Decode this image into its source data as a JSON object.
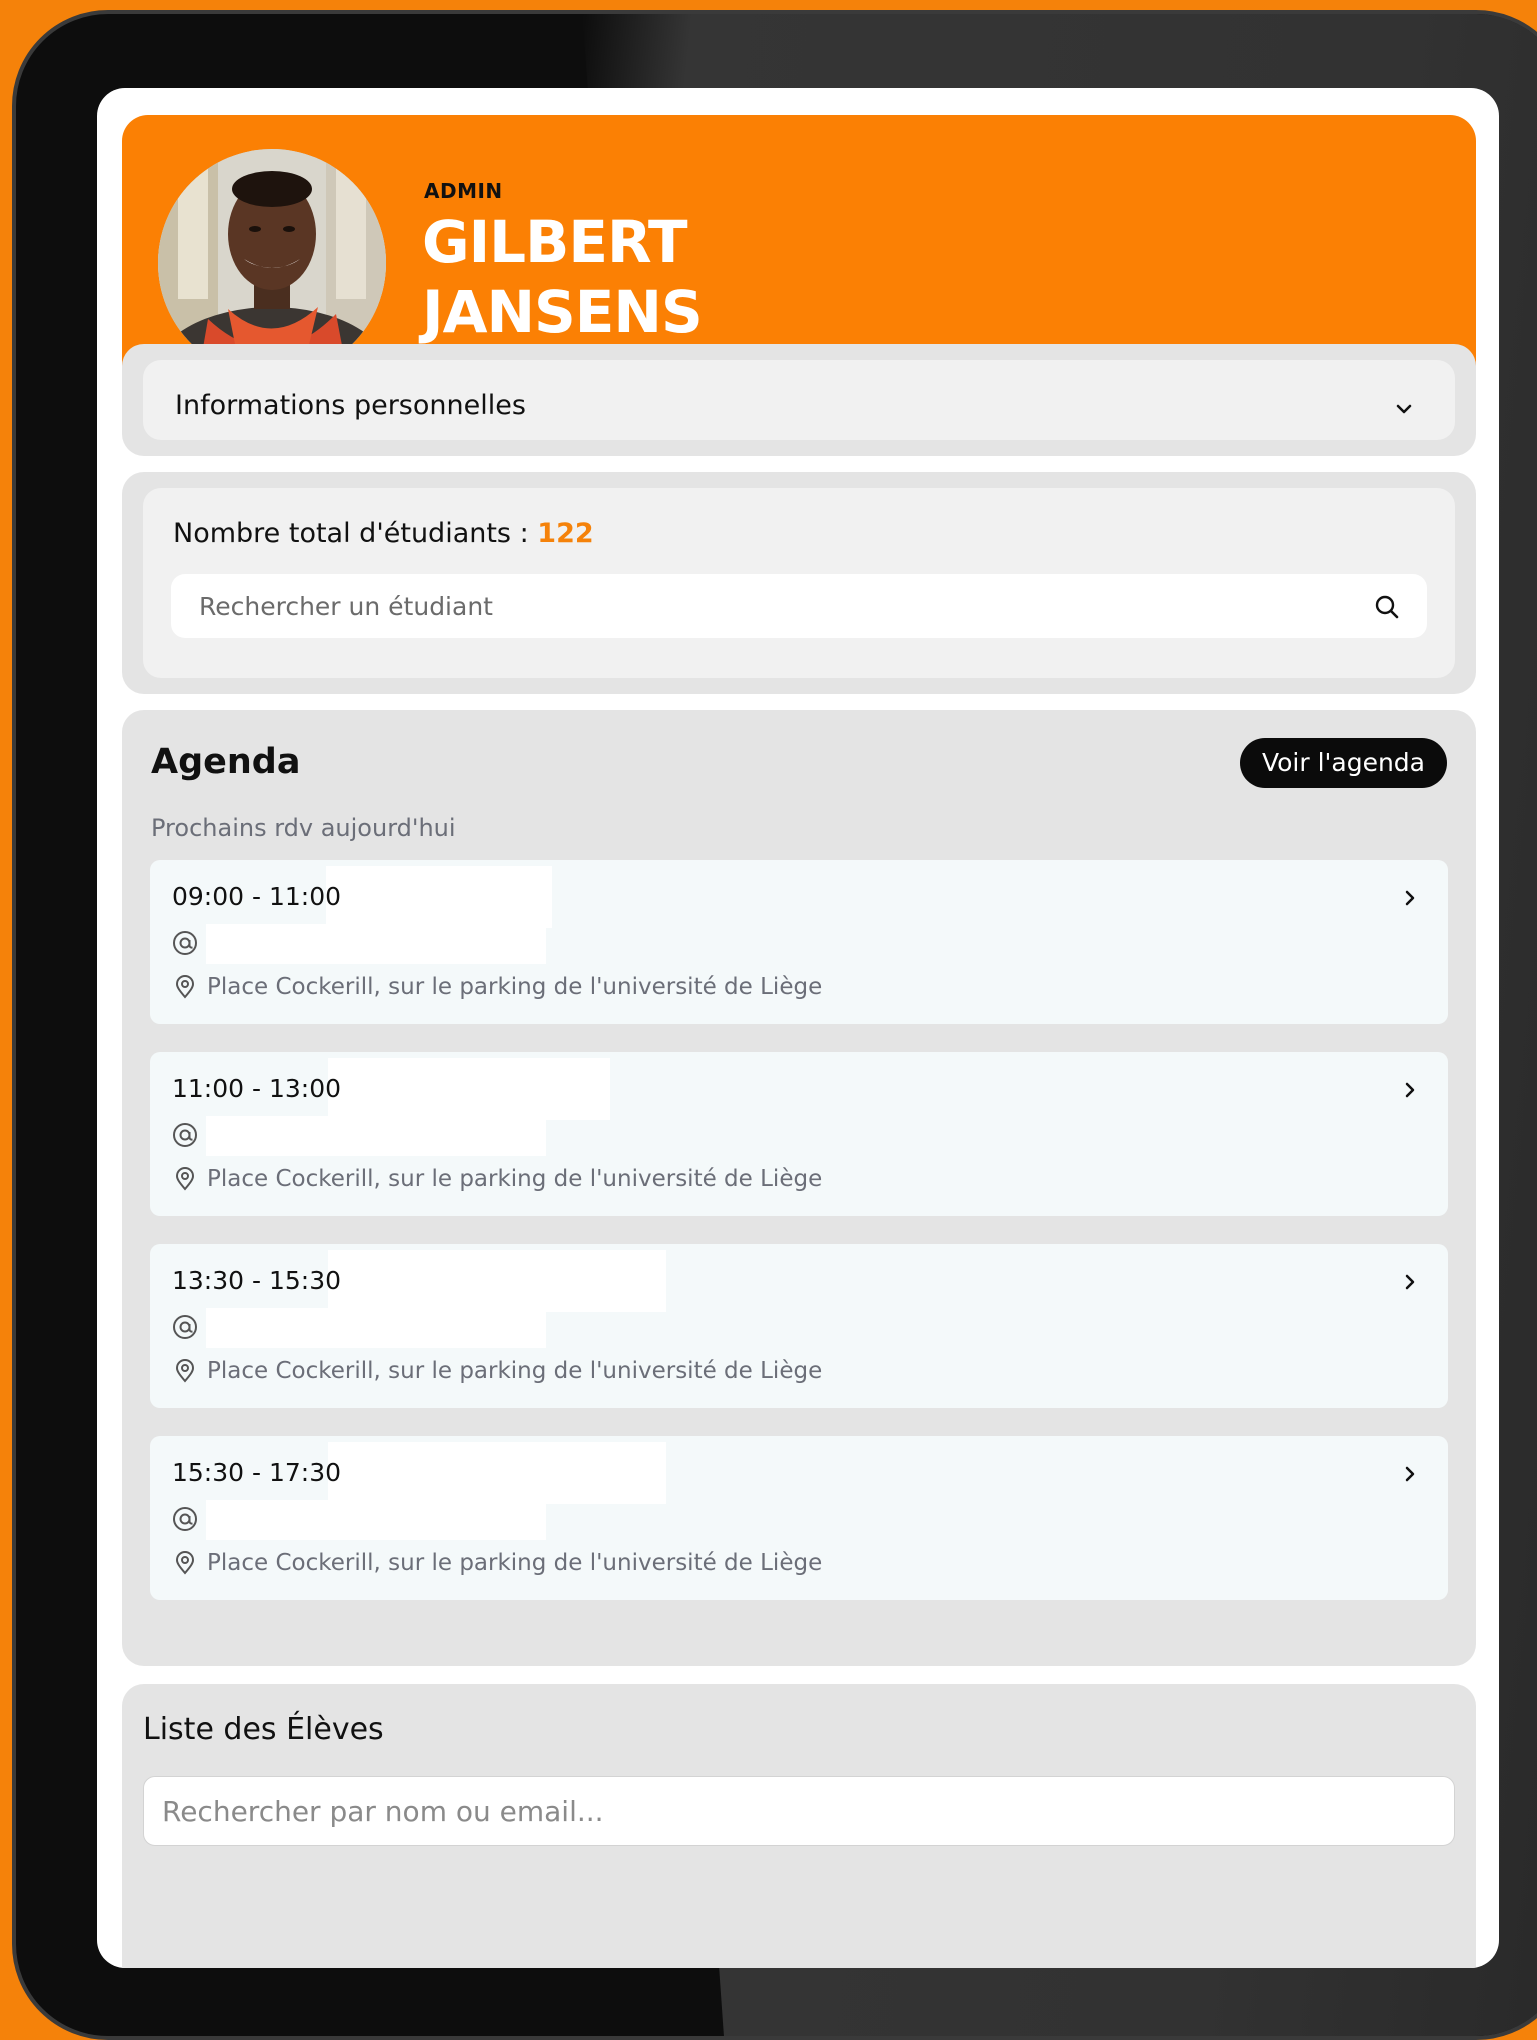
{
  "header": {
    "role": "ADMIN",
    "name_line1": "GILBERT",
    "name_line2": "JANSENS",
    "color": "#fb8004"
  },
  "info": {
    "label": "Informations personnelles",
    "icon": "chevron-down-icon"
  },
  "students": {
    "label": "Nombre total d'étudiants :",
    "count": "122",
    "search_placeholder": "Rechercher un étudiant",
    "icon": "search-icon"
  },
  "agenda": {
    "title": "Agenda",
    "button_label": "Voir l'agenda",
    "subtitle": "Prochains rdv aujourd'hui",
    "appointments": [
      {
        "time": "09:00 - 11:00",
        "location": "Place Cockerill, sur le parking de l'université de Liège"
      },
      {
        "time": "11:00 - 13:00",
        "location": "Place Cockerill, sur le parking de l'université de Liège"
      },
      {
        "time": "13:30 - 15:30",
        "location": "Place Cockerill, sur le parking de l'université de Liège"
      },
      {
        "time": "15:30 - 17:30",
        "location": "Place Cockerill, sur le parking de l'université de Liège"
      }
    ]
  },
  "students_list": {
    "title": "Liste des Élèves",
    "search_placeholder": "Rechercher par nom ou email..."
  }
}
